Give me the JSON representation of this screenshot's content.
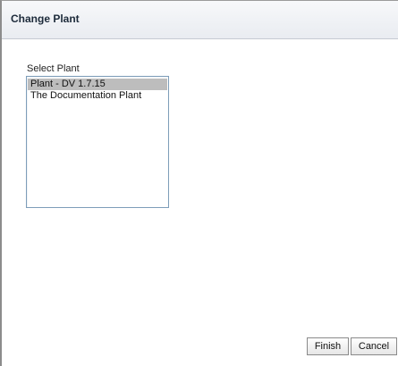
{
  "dialog": {
    "title": "Change Plant"
  },
  "plant_select": {
    "label": "Select Plant",
    "items": [
      {
        "label": "Plant - DV 1.7.15",
        "selected": true
      },
      {
        "label": "The Documentation Plant",
        "selected": false
      }
    ]
  },
  "buttons": {
    "finish_label": "Finish",
    "cancel_label": "Cancel"
  }
}
